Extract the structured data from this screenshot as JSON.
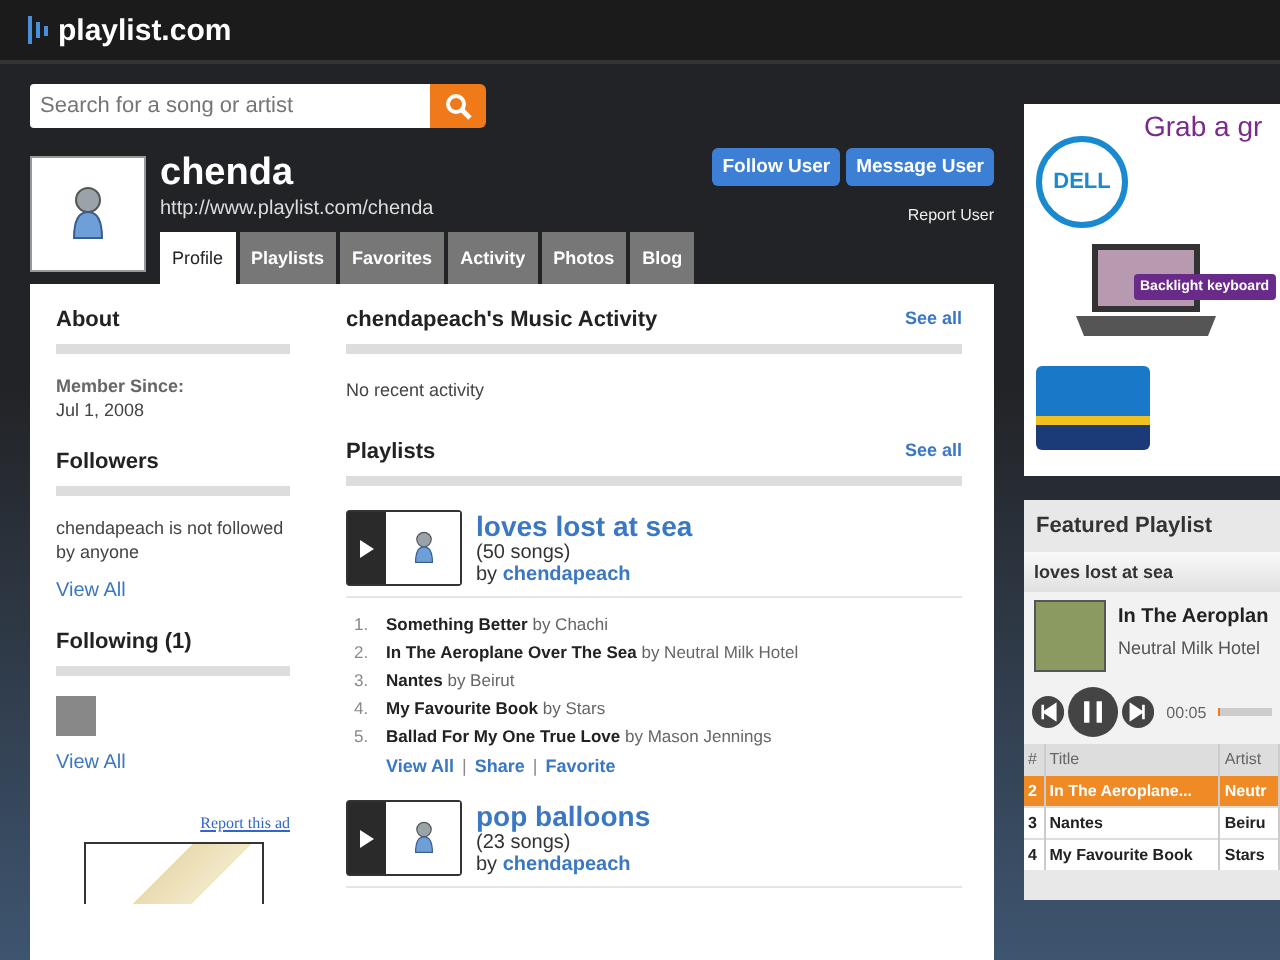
{
  "header": {
    "logo": "playlist.com"
  },
  "search": {
    "placeholder": "Search for a song or artist"
  },
  "profile": {
    "name": "chenda",
    "url": "http://www.playlist.com/chenda",
    "buttons": [
      "Follow User",
      "Message User"
    ],
    "report": "Report User"
  },
  "tabs": [
    {
      "label": "Profile",
      "selected": true
    },
    {
      "label": "Playlists",
      "selected": false
    },
    {
      "label": "Favorites",
      "selected": false
    },
    {
      "label": "Activity",
      "selected": false
    },
    {
      "label": "Photos",
      "selected": false
    },
    {
      "label": "Blog",
      "selected": false
    }
  ],
  "sidebar": {
    "about": {
      "title": "About",
      "label": "Member Since:",
      "value": "Jul 1, 2008"
    },
    "followers": {
      "title": "Followers",
      "text": "chendapeach is not followed by anyone",
      "link": "View All"
    },
    "following": {
      "title": "Following (1)",
      "link": "View All"
    },
    "report_ad": "Report this ad"
  },
  "activity": {
    "title": "chendapeach's Music Activity",
    "see_all": "See all",
    "empty": "No recent activity"
  },
  "playlists": {
    "title": "Playlists",
    "see_all": "See all",
    "items": [
      {
        "title": "loves lost at sea",
        "count": "(50 songs)",
        "by": "by",
        "owner": "chendapeach",
        "songs": [
          {
            "num": "1.",
            "title": "Something Better",
            "artist": "by Chachi"
          },
          {
            "num": "2.",
            "title": "In The Aeroplane Over The Sea",
            "artist": "by Neutral Milk Hotel"
          },
          {
            "num": "3.",
            "title": "Nantes",
            "artist": "by Beirut"
          },
          {
            "num": "4.",
            "title": "My Favourite Book",
            "artist": "by Stars"
          },
          {
            "num": "5.",
            "title": "Ballad For My One True Love",
            "artist": "by Mason Jennings"
          }
        ],
        "links": [
          "View All",
          "Share",
          "Favorite"
        ],
        "separators": [
          "|",
          "|"
        ]
      },
      {
        "title": "pop balloons",
        "count": "(23 songs)",
        "by": "by",
        "owner": "chendapeach"
      }
    ]
  },
  "ad": {
    "headline": "Grab a gr",
    "logo": "DELL",
    "badge": "Backlight keyboard"
  },
  "featured": {
    "title": "Featured Playlist",
    "playlist": "loves lost at sea",
    "track": "In The Aeroplan",
    "artist": "Neutral Milk Hotel",
    "time": "00:05",
    "level": 0.04,
    "columns": [
      "#",
      "Title",
      "Artist"
    ],
    "rows": [
      {
        "num": "2",
        "title": "In The Aeroplane...",
        "artist": "Neutr",
        "selected": true
      },
      {
        "num": "3",
        "title": "Nantes",
        "artist": "Beiru",
        "selected": false
      },
      {
        "num": "4",
        "title": "My Favourite Book",
        "artist": "Stars",
        "selected": false
      }
    ]
  }
}
